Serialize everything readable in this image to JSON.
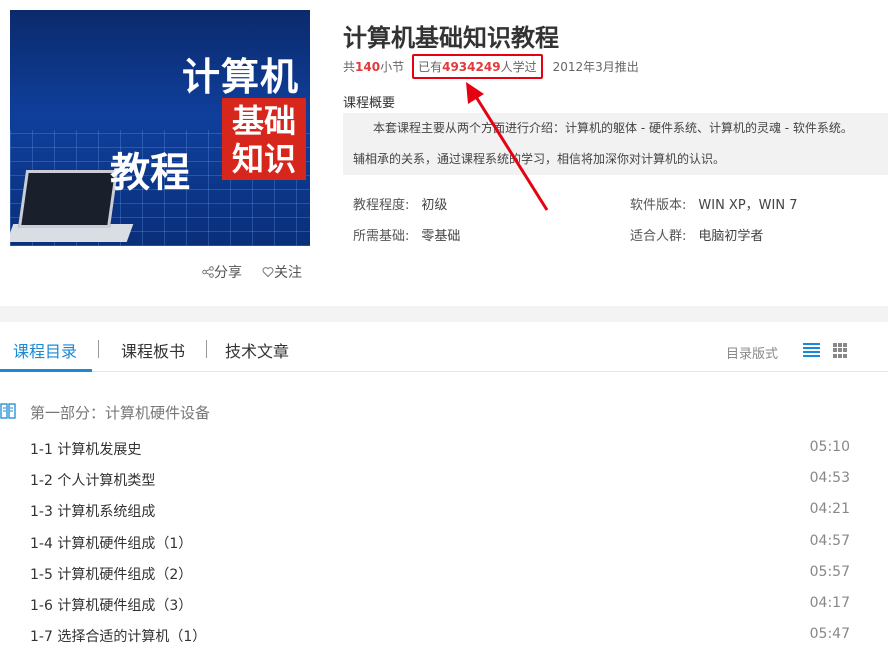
{
  "course": {
    "cover": {
      "line1": "计算机",
      "badge_line1": "基础",
      "badge_line2": "知识",
      "line2": "教程"
    },
    "title": "计算机基础知识教程",
    "meta": {
      "prefix": "共",
      "sections_count": "140",
      "sections_suffix": "小节",
      "learners_prefix": "已有",
      "learners_count": "4934249",
      "learners_suffix": "人学过",
      "release": "2012年3月推出"
    },
    "overview_label": "课程概要",
    "overview_line1": "本套课程主要从两个方面进行介绍：计算机的躯体 - 硬件系统、计算机的灵魂 - 软件系统。",
    "overview_line2": "辅相承的关系，通过课程系统的学习，相信将加深你对计算机的认识。",
    "info": {
      "level_label": "教程程度:",
      "level_value": "初级",
      "prereq_label": "所需基础:",
      "prereq_value": "零基础",
      "software_label": "软件版本:",
      "software_value": "WIN XP，WIN 7",
      "audience_label": "适合人群:",
      "audience_value": "电脑初学者"
    },
    "actions": {
      "share": "分享",
      "follow": "关注"
    }
  },
  "tabs": {
    "items": [
      {
        "label": "课程目录",
        "active": true
      },
      {
        "label": "课程板书",
        "active": false
      },
      {
        "label": "技术文章",
        "active": false
      }
    ],
    "view_label": "目录版式"
  },
  "catalog": {
    "section_title": "第一部分：计算机硬件设备",
    "lessons": [
      {
        "name": "1-1 计算机发展史",
        "duration": "05:10"
      },
      {
        "name": "1-2 个人计算机类型",
        "duration": "04:53"
      },
      {
        "name": "1-3 计算机系统组成",
        "duration": "04:21"
      },
      {
        "name": "1-4 计算机硬件组成（1）",
        "duration": "04:57"
      },
      {
        "name": "1-5 计算机硬件组成（2）",
        "duration": "05:57"
      },
      {
        "name": "1-6 计算机硬件组成（3）",
        "duration": "04:17"
      },
      {
        "name": "1-7 选择合适的计算机（1）",
        "duration": "05:47"
      }
    ]
  },
  "colors": {
    "accent": "#1b8ad6",
    "highlight_red": "#e60012",
    "number_red": "#e4393c"
  }
}
